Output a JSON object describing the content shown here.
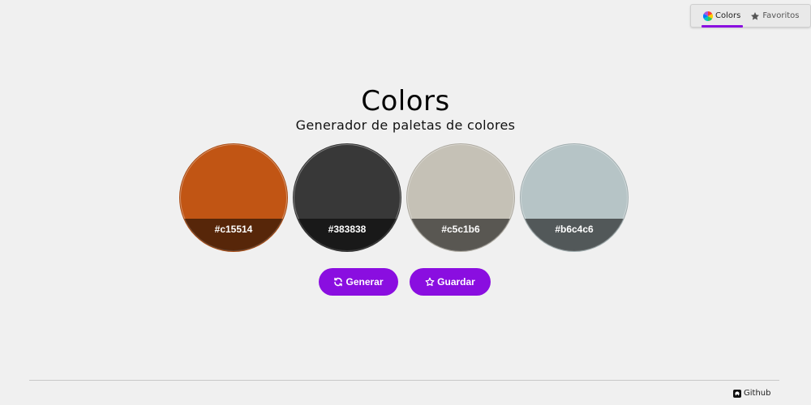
{
  "nav": {
    "items": [
      {
        "label": "Colors",
        "icon": "color-wheel-icon",
        "active": true
      },
      {
        "label": "Favoritos",
        "icon": "star-icon",
        "active": false
      }
    ]
  },
  "header": {
    "title": "Colors",
    "subtitle": "Generador de paletas de colores"
  },
  "palette": [
    {
      "hex": "#c15514",
      "label": "#c15514"
    },
    {
      "hex": "#383838",
      "label": "#383838"
    },
    {
      "hex": "#c5c1b6",
      "label": "#c5c1b6"
    },
    {
      "hex": "#b6c4c6",
      "label": "#b6c4c6"
    }
  ],
  "actions": {
    "generate_label": "Generar",
    "save_label": "Guardar"
  },
  "footer": {
    "github_label": "Github"
  },
  "colors": {
    "accent": "#8a0ee0",
    "background": "#f0f0f0"
  }
}
